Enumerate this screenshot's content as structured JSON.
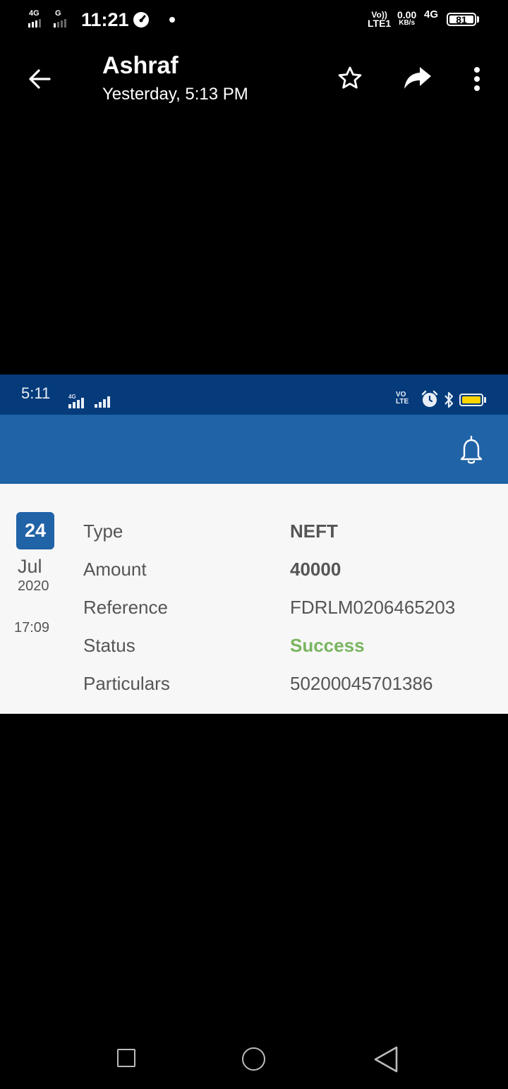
{
  "status_bar": {
    "sim1_net": "4G",
    "sim2_net": "G",
    "time": "11:21",
    "volte_top": "Vo))",
    "volte_bottom": "LTE1",
    "speed_value": "0.00",
    "speed_unit": "KB/s",
    "net_type": "4G",
    "battery": "81"
  },
  "header": {
    "title": "Ashraf",
    "subtitle": "Yesterday, 5:13 PM",
    "back_icon": "back-arrow-icon",
    "star_icon": "star-icon",
    "share_icon": "share-icon",
    "menu_icon": "more-vert-icon"
  },
  "embedded": {
    "status_time": "5:11",
    "status_net": "4G",
    "volte_label": "VO LTE",
    "bell_icon": "bell-icon",
    "accent_color": "#2063a7",
    "date": {
      "day": "24",
      "month": "Jul",
      "year": "2020",
      "time": "17:09"
    },
    "details": [
      {
        "label": "Type",
        "value": "NEFT"
      },
      {
        "label": "Amount",
        "value": "40000"
      },
      {
        "label": "Reference",
        "value": "FDRLM0206465203"
      },
      {
        "label": "Status",
        "value": "Success"
      },
      {
        "label": "Particulars",
        "value": "50200045701386"
      }
    ],
    "success_color": "#7ab560"
  },
  "nav_bar": {
    "recents_icon": "square-icon",
    "home_icon": "circle-icon",
    "back_icon": "triangle-back-icon"
  }
}
